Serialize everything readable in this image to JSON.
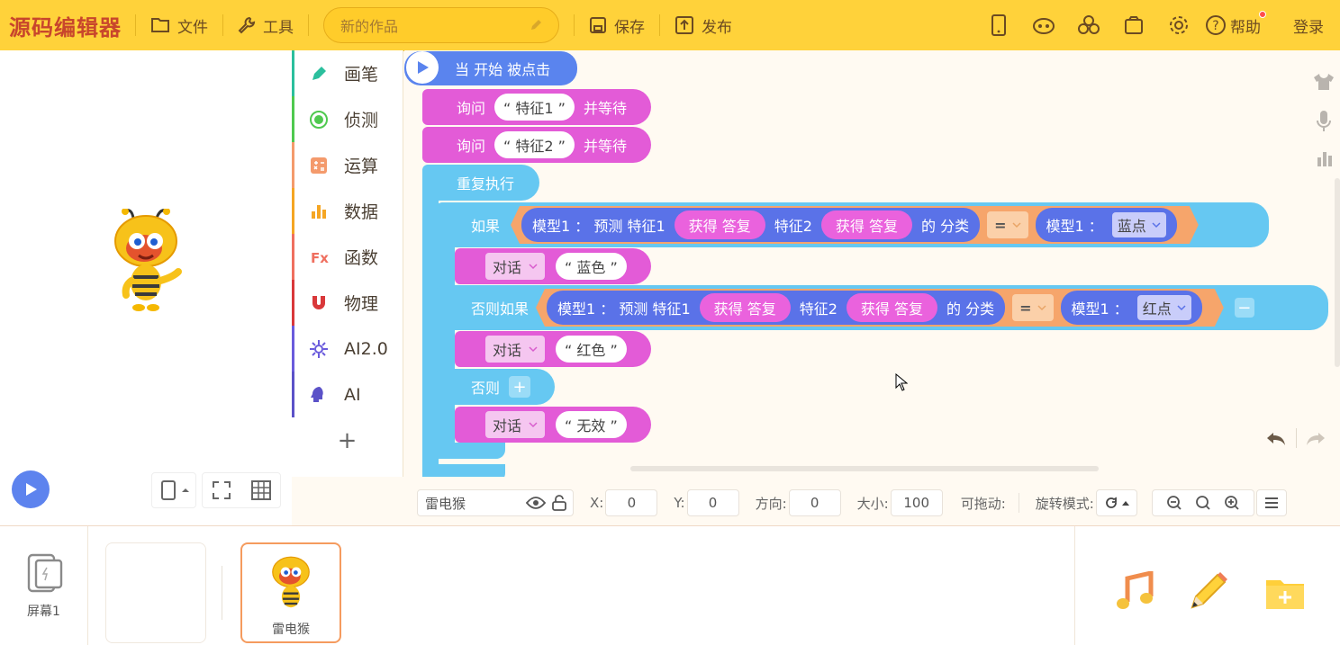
{
  "app": {
    "logo": "源码编辑器"
  },
  "topbar": {
    "file": "文件",
    "tools": "工具",
    "project_title": "新的作品",
    "save": "保存",
    "publish": "发布",
    "help": "帮助",
    "login": "登录"
  },
  "categories": [
    {
      "label": "画笔",
      "color": "#2bbf9d",
      "icon": "pen-icon"
    },
    {
      "label": "侦测",
      "color": "#4fc94f",
      "icon": "detect-icon"
    },
    {
      "label": "运算",
      "color": "#f49a6c",
      "icon": "calc-icon"
    },
    {
      "label": "数据",
      "color": "#f5a623",
      "icon": "data-icon"
    },
    {
      "label": "函数",
      "color": "#ef6f5f",
      "icon": "function-icon"
    },
    {
      "label": "物理",
      "color": "#d9383a",
      "icon": "magnet-icon"
    },
    {
      "label": "AI2.0",
      "color": "#6a5bdc",
      "icon": "ai2-icon"
    },
    {
      "label": "AI",
      "color": "#5b52c8",
      "icon": "ai-icon"
    }
  ],
  "blocks": {
    "when_clicked": "当 开始 被点击",
    "ask_prefix": "询问",
    "ask_suffix": "并等待",
    "ask1": "“ 特征1 ”",
    "ask2": "“ 特征2 ”",
    "repeat": "重复执行",
    "if": "如果",
    "else_if": "否则如果",
    "else": "否则",
    "model_predict": "模型1 ： 预测  特征1",
    "get_answer": "获得 答复",
    "feature2": "特征2",
    "classify": "的 分类",
    "eq": "=",
    "model_label": "模型1 ：",
    "blue_point": "蓝点",
    "red_point": "红点",
    "say": "对话",
    "say_blue": "“ 蓝色 ”",
    "say_red": "“ 红色 ”",
    "say_invalid": "“ 无效 ”"
  },
  "props": {
    "sprite_name": "雷电猴",
    "x_label": "X:",
    "x": "0",
    "y_label": "Y:",
    "y": "0",
    "dir_label": "方向:",
    "dir": "0",
    "size_label": "大小:",
    "size": "100",
    "drag_label": "可拖动:",
    "rot_label": "旋转模式:"
  },
  "bottom": {
    "screen": "屏幕1",
    "sprite": "雷电猴"
  }
}
